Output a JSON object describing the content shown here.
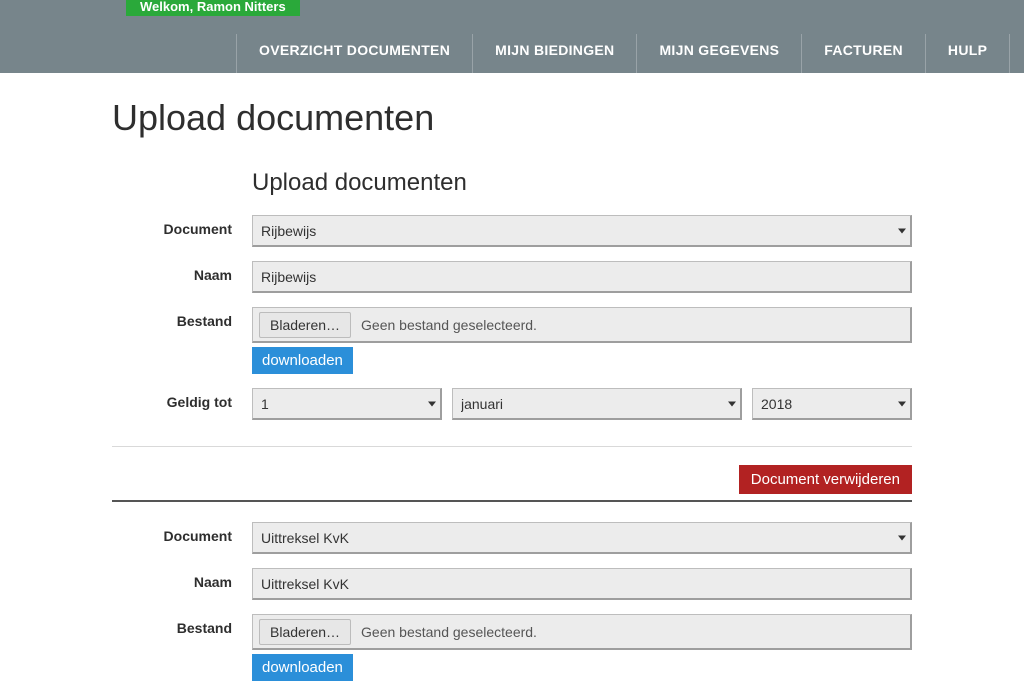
{
  "header": {
    "welcome": "Welkom, Ramon Nitters",
    "nav": [
      "OVERZICHT DOCUMENTEN",
      "MIJN BIEDINGEN",
      "MIJN GEGEVENS",
      "FACTUREN",
      "HULP"
    ]
  },
  "page": {
    "title": "Upload documenten"
  },
  "form": {
    "section_title": "Upload documenten",
    "labels": {
      "document": "Document",
      "name": "Naam",
      "file": "Bestand",
      "valid_until": "Geldig tot"
    },
    "browse_label": "Bladeren…",
    "file_status": "Geen bestand geselecteerd.",
    "download_label": "downloaden",
    "delete_label": "Document verwijderen",
    "block1": {
      "document_value": "Rijbewijs",
      "name_value": "Rijbewijs",
      "date": {
        "day": "1",
        "month": "januari",
        "year": "2018"
      }
    },
    "block2": {
      "document_value": "Uittreksel KvK",
      "name_value": "Uittreksel KvK"
    }
  }
}
